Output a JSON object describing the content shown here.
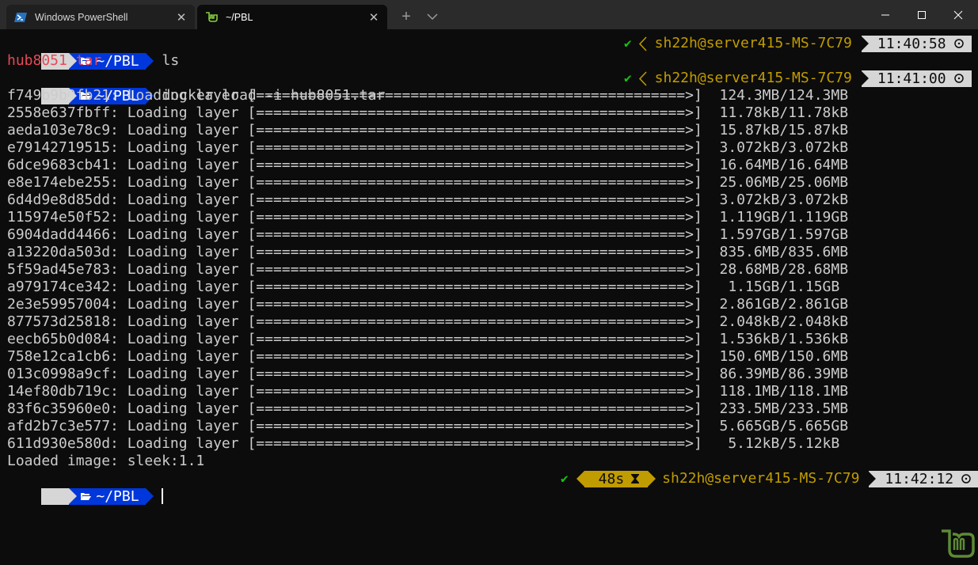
{
  "tabs": [
    {
      "label": "Windows PowerShell",
      "icon": "powershell-icon"
    },
    {
      "label": "~/PBL",
      "icon": "linux-mint-icon"
    }
  ],
  "window_controls": {
    "minimize": "minimize-icon",
    "maximize": "maximize-icon",
    "close": "close-icon"
  },
  "colors": {
    "dir_segment": "#0037da",
    "host": "#c19c00",
    "success": "#16c60c",
    "error_file": "#e74856",
    "time_segment": "#d6d6d6"
  },
  "prompts": [
    {
      "dir": "~/PBL",
      "command": "ls",
      "status": "✔",
      "host": "sh22h@server415-MS-7C79",
      "time": "11:40:58"
    },
    {
      "dir": "~/PBL",
      "command": "docker load -i hub8051.tar",
      "status": "✔",
      "host": "sh22h@server415-MS-7C79",
      "time": "11:41:00"
    },
    {
      "dir": "~/PBL",
      "command": "",
      "status": "✔",
      "duration": "48s",
      "host": "sh22h@server415-MS-7C79",
      "time": "11:42:12"
    }
  ],
  "ls_output": "hub8051.tar",
  "layers": [
    {
      "id": "f749b9b0fb21",
      "size": "124.3MB/124.3MB"
    },
    {
      "id": "2558e637fbff",
      "size": "11.78kB/11.78kB"
    },
    {
      "id": "aeda103e78c9",
      "size": "15.87kB/15.87kB"
    },
    {
      "id": "e79142719515",
      "size": "3.072kB/3.072kB"
    },
    {
      "id": "6dce9683cb41",
      "size": "16.64MB/16.64MB"
    },
    {
      "id": "e8e174ebe255",
      "size": "25.06MB/25.06MB"
    },
    {
      "id": "6d4d9e8d85dd",
      "size": "3.072kB/3.072kB"
    },
    {
      "id": "115974e50f52",
      "size": "1.119GB/1.119GB"
    },
    {
      "id": "6904dadd4466",
      "size": "1.597GB/1.597GB"
    },
    {
      "id": "a13220da503d",
      "size": "835.6MB/835.6MB"
    },
    {
      "id": "5f59ad45e783",
      "size": "28.68MB/28.68MB"
    },
    {
      "id": "a979174ce342",
      "size": " 1.15GB/1.15GB"
    },
    {
      "id": "2e3e59957004",
      "size": "2.861GB/2.861GB"
    },
    {
      "id": "877573d25818",
      "size": "2.048kB/2.048kB"
    },
    {
      "id": "eecb65b0d084",
      "size": "1.536kB/1.536kB"
    },
    {
      "id": "758e12ca1cb6",
      "size": "150.6MB/150.6MB"
    },
    {
      "id": "013c0998a9cf",
      "size": "86.39MB/86.39MB"
    },
    {
      "id": "14ef80db719c",
      "size": "118.1MB/118.1MB"
    },
    {
      "id": "83f6c35960e0",
      "size": "233.5MB/233.5MB"
    },
    {
      "id": "afd2b7c3e577",
      "size": "5.665GB/5.665GB"
    },
    {
      "id": "611d930e580d",
      "size": " 5.12kB/5.12kB"
    }
  ],
  "layer_text": ": Loading layer ",
  "progress_bar": "[==================================================>]",
  "loaded_message": "Loaded image: sleek:1.1"
}
